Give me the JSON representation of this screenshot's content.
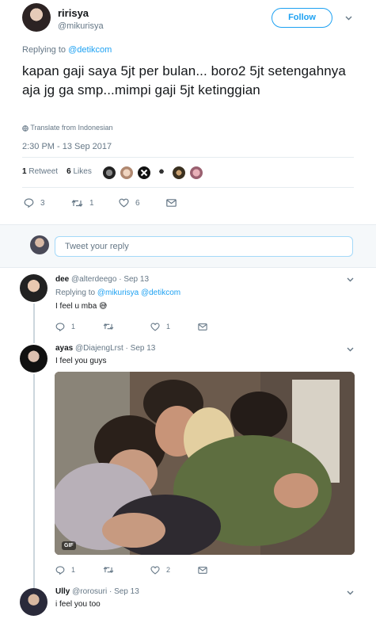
{
  "tweet": {
    "author_name": "ririsya",
    "author_handle": "@mikurisya",
    "follow_label": "Follow",
    "replying_prefix": "Replying to",
    "replying_mention": "@detikcom",
    "text": "kapan gaji saya 5jt per bulan... boro2 5jt setengahnya aja jg ga smp...mimpi gaji 5jt ketinggian",
    "translate_label": "Translate from Indonesian",
    "timestamp": "2:30 PM - 13 Sep 2017",
    "retweet_count": "1",
    "retweet_label": "Retweet",
    "like_count": "6",
    "like_label": "Likes",
    "action_reply_count": "3",
    "action_retweet_count": "1",
    "action_like_count": "6"
  },
  "reply_box": {
    "placeholder": "Tweet your reply"
  },
  "replies": [
    {
      "name": "dee",
      "handle": "@alterdeego",
      "date": "· Sep 13",
      "replying_prefix": "Replying to",
      "replying_mentions": "@mikurisya @detikcom",
      "text": "I feel u mba 😅",
      "reply_count": "1",
      "retweet_count": "",
      "like_count": "1"
    },
    {
      "name": "ayas",
      "handle": "@DiajengLrst",
      "date": "· Sep 13",
      "text": "I feel you guys",
      "media_badge": "GIF",
      "reply_count": "1",
      "retweet_count": "",
      "like_count": "2"
    },
    {
      "name": "Ully",
      "handle": "@rorosuri",
      "date": "· Sep 13",
      "text": "i feel you too"
    }
  ],
  "colors": {
    "accent": "#1da1f2",
    "secondary_text": "#657786",
    "primary_text": "#14171a",
    "divider": "#e6ecf0"
  }
}
